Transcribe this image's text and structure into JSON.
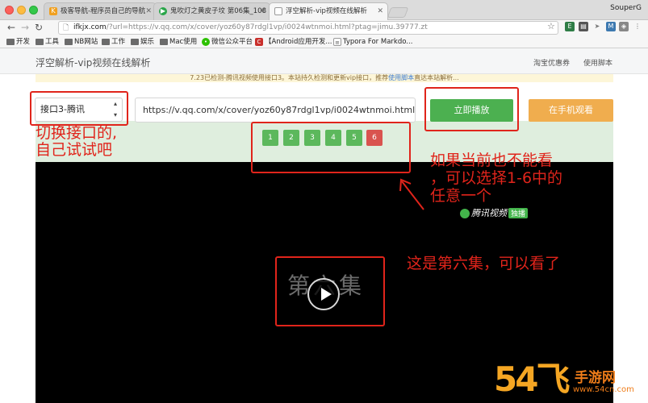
{
  "browser": {
    "tabs": [
      {
        "title": "极客导航-程序员自己的导航",
        "favicon": "K",
        "active": false
      },
      {
        "title": "鬼吹灯之黄皮子坟 第06集_108",
        "favicon": "▶",
        "active": false
      },
      {
        "title": "浮空解析-vip视频在线解析",
        "favicon": "",
        "active": true
      }
    ],
    "profile_name": "SouperG",
    "address": {
      "host": "ifkjx.com",
      "rest": "/?url=https://v.qq.com/x/cover/yoz60y87rdgl1vp/i0024wtnmoi.html?ptag=jimu.39777.zt"
    },
    "bookmarks": [
      {
        "label": "开发",
        "icon": "folder"
      },
      {
        "label": "工具",
        "icon": "folder"
      },
      {
        "label": "NB网站",
        "icon": "folder"
      },
      {
        "label": "工作",
        "icon": "folder"
      },
      {
        "label": "娱乐",
        "icon": "folder"
      },
      {
        "label": "Mac使用",
        "icon": "folder"
      },
      {
        "label": "微信公众平台",
        "icon": "wechat"
      },
      {
        "label": "【Android应用开发...",
        "icon": "c-red"
      },
      {
        "label": "Typora For Markdo...",
        "icon": "doc"
      }
    ]
  },
  "site": {
    "brand": "浮空解析-vip视频在线解析",
    "nav": [
      "淘宝优惠券",
      "使用脚本"
    ],
    "notice_pre": "7.23已检测-腾讯视频使用接口3。本站持久检测和更新vip接口，推荐",
    "notice_link": "使用脚本",
    "notice_post": "直达本站解析..."
  },
  "form": {
    "interface_select": "接口3-腾讯",
    "url_value": "https://v.qq.com/x/cover/yoz60y87rdgl1vp/i0024wtnmoi.html",
    "play_label": "立即播放",
    "mobile_label": "在手机观看"
  },
  "episodes": {
    "items": [
      "1",
      "2",
      "3",
      "4",
      "5",
      "6"
    ],
    "selected_index": 5
  },
  "video": {
    "logo_text": "腾讯视频",
    "logo_badge": "独播",
    "title_text": "第六集"
  },
  "annotations": {
    "switch_interface": [
      "切换接口的,",
      "自己试试吧"
    ],
    "choose_episode": [
      "如果当前也不能看",
      "，可以选择1-6中的",
      "任意一个"
    ],
    "episode_six": "这是第六集，可以看了"
  },
  "watermark": {
    "big": "54飞",
    "cn": "手游网",
    "url": "www.54cn.com"
  },
  "colors": {
    "play_green": "#4cb050",
    "mobile_orange": "#f0ad4e",
    "episode_green": "#5cb85c",
    "episode_selected": "#d9534f",
    "annotation_red": "#e0241b"
  }
}
